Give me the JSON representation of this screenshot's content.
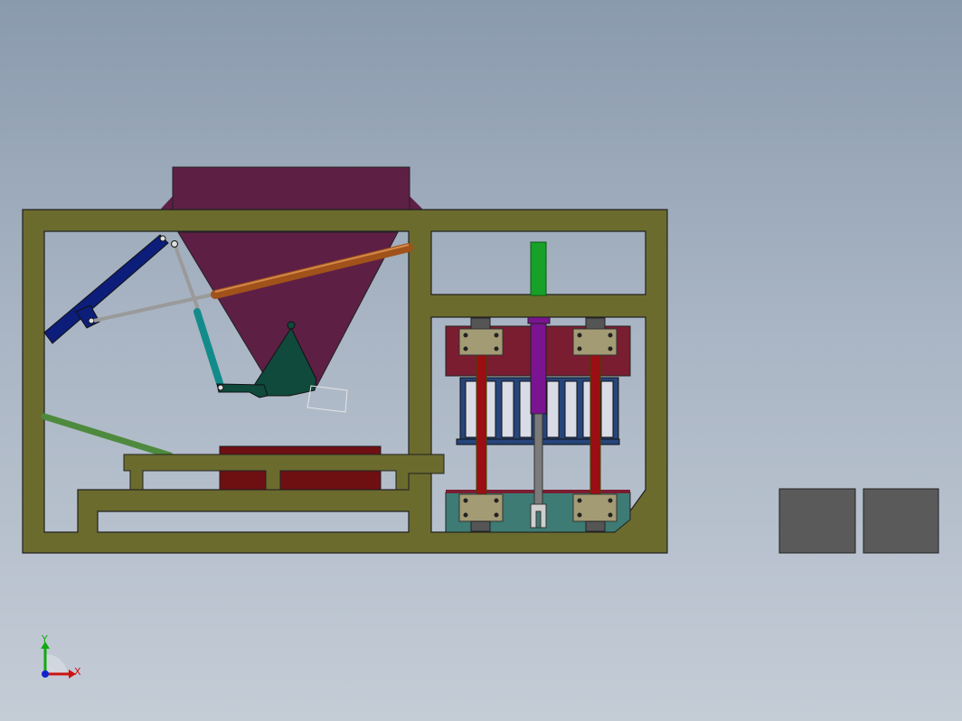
{
  "viewport": {
    "background_top": "#8a9aad",
    "background_bottom": "#c4ccd6"
  },
  "model": {
    "frame_color": "#6b6b2e",
    "hopper_color": "#5e1f45",
    "hopper_shade": "#7a2a57",
    "bucket_color": "#0f4a3c",
    "arm_color": "#0c1e7a",
    "rod_color": "#9a9a9a",
    "cylinder_orange": "#a0521a",
    "cylinder_teal": "#138b8b",
    "cylinder_green": "#4e8a3e",
    "pallet_red": "#6e0f12",
    "mold_top_color": "#7a1d30",
    "mold_grid_color": "#26457a",
    "guide_rod_color": "#9a0e14",
    "clamp_color": "#a39b74",
    "press_cylinder_color": "#7a1490",
    "vertical_green_cylinder": "#17a128",
    "base_plate_color": "#3d7b74",
    "block_color": "#5a5a5a"
  },
  "triad": {
    "x_label": "X",
    "y_label": "Y",
    "x_color": "#cc1111",
    "y_color": "#11aa11",
    "z_color": "#1122cc"
  }
}
